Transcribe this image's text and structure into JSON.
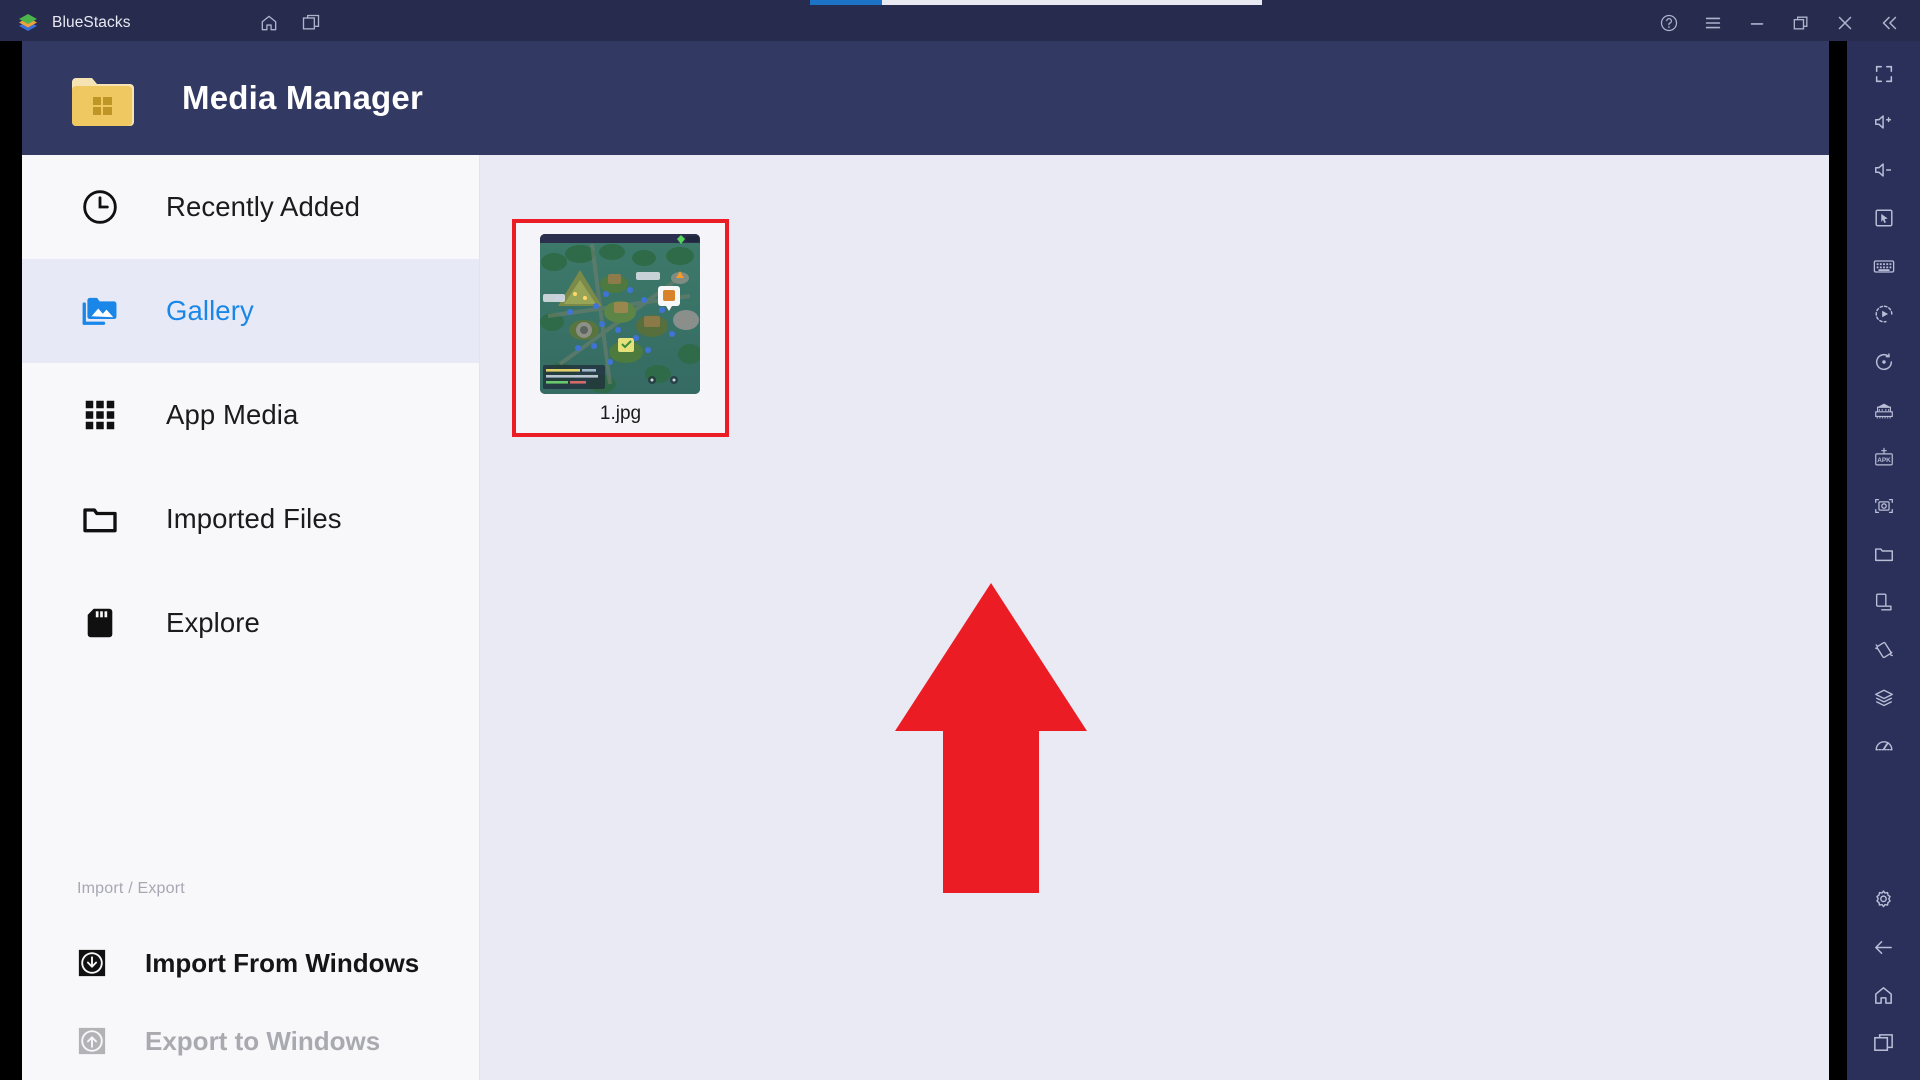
{
  "window": {
    "app_name": "BlueStacks",
    "logo_icon": "bluestacks-logo-icon",
    "center_controls": [
      {
        "name": "home-icon",
        "label": "Home"
      },
      {
        "name": "multi-instance-icon",
        "label": "Multi-instance"
      }
    ],
    "controls": [
      {
        "name": "help-icon",
        "label": "Help"
      },
      {
        "name": "menu-icon",
        "label": "Menu"
      },
      {
        "name": "minimize-icon",
        "label": "Minimize"
      },
      {
        "name": "maximize-icon",
        "label": "Maximize"
      },
      {
        "name": "close-icon",
        "label": "Close"
      },
      {
        "name": "collapse-icon",
        "label": "Collapse"
      }
    ],
    "loading_bar": {
      "visible": true,
      "accent_color": "#1c72c4"
    }
  },
  "header": {
    "title": "Media Manager",
    "icon": "windows-folder-icon",
    "background_color": "#323a63",
    "icon_color": "#f0c862"
  },
  "sidebar": {
    "items": [
      {
        "label": "Recently Added",
        "icon": "clock-icon",
        "active": false
      },
      {
        "label": "Gallery",
        "icon": "photo-folder-icon",
        "active": true
      },
      {
        "label": "App Media",
        "icon": "grid-icon",
        "active": false
      },
      {
        "label": "Imported Files",
        "icon": "folder-icon",
        "active": false
      },
      {
        "label": "Explore",
        "icon": "sd-card-icon",
        "active": false
      }
    ],
    "active_color": "#1a87e8",
    "active_bg": "#e7e9f6",
    "import_export": {
      "section_label": "Import / Export",
      "items": [
        {
          "label": "Import From Windows",
          "icon": "import-down-icon",
          "disabled": false
        },
        {
          "label": "Export to Windows",
          "icon": "export-up-icon",
          "disabled": true
        }
      ]
    }
  },
  "content": {
    "files": [
      {
        "name": "1.jpg",
        "thumbnail": "game-map-screenshot",
        "selected": true,
        "highlight_color": "#ec1c24"
      }
    ]
  },
  "annotation": {
    "arrow": {
      "name": "pointer-arrow",
      "color": "#ec1c24",
      "direction": "up"
    }
  },
  "toolbar": {
    "items": [
      {
        "name": "fullscreen-icon",
        "label": "Fullscreen"
      },
      {
        "name": "volume-up-icon",
        "label": "Volume up"
      },
      {
        "name": "volume-down-icon",
        "label": "Volume down"
      },
      {
        "name": "cursor-icon",
        "label": "Game controls"
      },
      {
        "name": "keyboard-icon",
        "label": "Keyboard controls"
      },
      {
        "name": "macro-play-icon",
        "label": "Macro recorder"
      },
      {
        "name": "eco-mode-icon",
        "label": "Eco mode"
      },
      {
        "name": "multi-instance-manager-icon",
        "label": "Multi-instance manager"
      },
      {
        "name": "apk-install-icon",
        "label": "Install APK"
      },
      {
        "name": "screenshot-icon",
        "label": "Screenshot"
      },
      {
        "name": "media-manager-icon",
        "label": "Media manager"
      },
      {
        "name": "rotate-screen-icon",
        "label": "Rotate"
      },
      {
        "name": "shake-icon",
        "label": "Shake"
      },
      {
        "name": "layers-icon",
        "label": "Layers"
      },
      {
        "name": "gauge-icon",
        "label": "Performance"
      }
    ],
    "bottom_items": [
      {
        "name": "settings-gear-icon",
        "label": "Settings"
      },
      {
        "name": "back-arrow-icon",
        "label": "Back"
      },
      {
        "name": "home-icon",
        "label": "Home"
      },
      {
        "name": "recents-icon",
        "label": "Recent apps"
      }
    ]
  }
}
